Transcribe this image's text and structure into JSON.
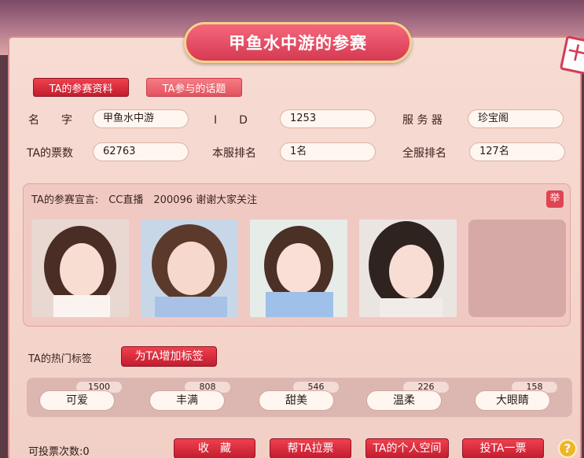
{
  "title": "甲鱼水中游的参赛",
  "tabs": [
    {
      "label": "TA的参赛资料"
    },
    {
      "label": "TA参与的话题"
    }
  ],
  "profile": {
    "name_label": "名　　字",
    "name_value": "甲鱼水中游",
    "id_label": "I　　D",
    "id_value": "1253",
    "server_label": "服 务 器",
    "server_value": "珍宝阁",
    "votes_label": "TA的票数",
    "votes_value": "62763",
    "server_rank_label": "本服排名",
    "server_rank_value": "1名",
    "global_rank_label": "全服排名",
    "global_rank_value": "127名"
  },
  "manifesto": {
    "text": "TA的参赛宣言:　CC直播　200096 谢谢大家关注",
    "report_label": "举"
  },
  "tags": {
    "hot_label": "TA的热门标签",
    "add_button": "为TA增加标签",
    "items": [
      {
        "label": "可爱",
        "count": "1500"
      },
      {
        "label": "丰满",
        "count": "808"
      },
      {
        "label": "甜美",
        "count": "546"
      },
      {
        "label": "温柔",
        "count": "226"
      },
      {
        "label": "大眼睛",
        "count": "158"
      }
    ]
  },
  "footer": {
    "votes_left": "可投票次数:0",
    "collect": "收　藏",
    "canvass": "帮TA拉票",
    "space": "TA的个人空间",
    "vote": "投TA一票",
    "help": "?"
  },
  "calendar_glyph": "十",
  "colors": {
    "accent": "#d63a53",
    "panel": "#f4d5cc",
    "gold": "#f6d28a"
  }
}
